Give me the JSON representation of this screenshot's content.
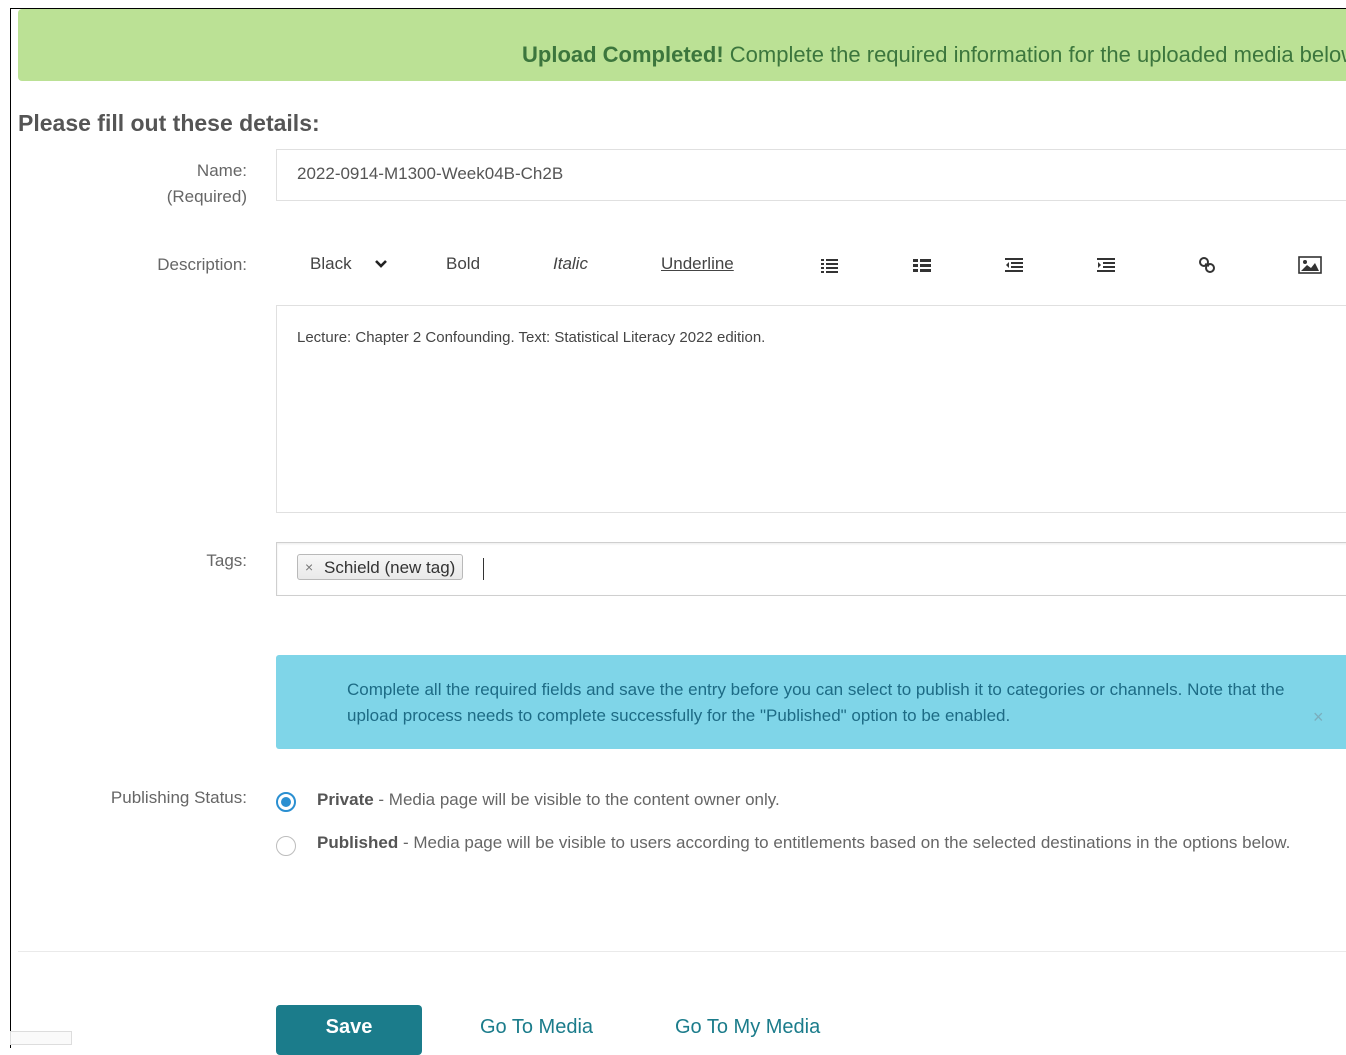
{
  "banner": {
    "strong": "Upload Completed!",
    "text": " Complete the required information for the uploaded media below."
  },
  "form": {
    "title": "Please fill out these details:",
    "name_label": "Name:",
    "name_required": "(Required)",
    "name_value": "2022-0914-M1300-Week04B-Ch2B",
    "description_label": "Description:",
    "toolbar": {
      "color": "Black",
      "bold": "Bold",
      "italic": "Italic",
      "underline": "Underline"
    },
    "description_value": "Lecture: Chapter 2  Confounding.  Text: Statistical Literacy 2022 edition.",
    "tags_label": "Tags:",
    "tags": [
      "Schield (new tag)"
    ],
    "tag_remove": "×",
    "info_message": "Complete all the required fields and save the entry before you can select to publish it to categories or channels. Note that the upload process needs to complete successfully for the \"Published\" option to be enabled.",
    "info_close": "×",
    "publishing_label": "Publishing Status:",
    "options": [
      {
        "name": "Private",
        "desc": " - Media page will be visible to the content owner only.",
        "selected": true
      },
      {
        "name": "Published",
        "desc": " - Media page will be visible to users according to entitlements based on the selected destinations in the options below.",
        "selected": false
      }
    ]
  },
  "actions": {
    "save": "Save",
    "go_to_media": "Go To Media",
    "go_to_my_media": "Go To My Media"
  },
  "colors": {
    "success_bg": "#bbe195",
    "info_bg": "#7fd5e8",
    "primary": "#1b7c8b",
    "radio": "#2a8fd1"
  }
}
